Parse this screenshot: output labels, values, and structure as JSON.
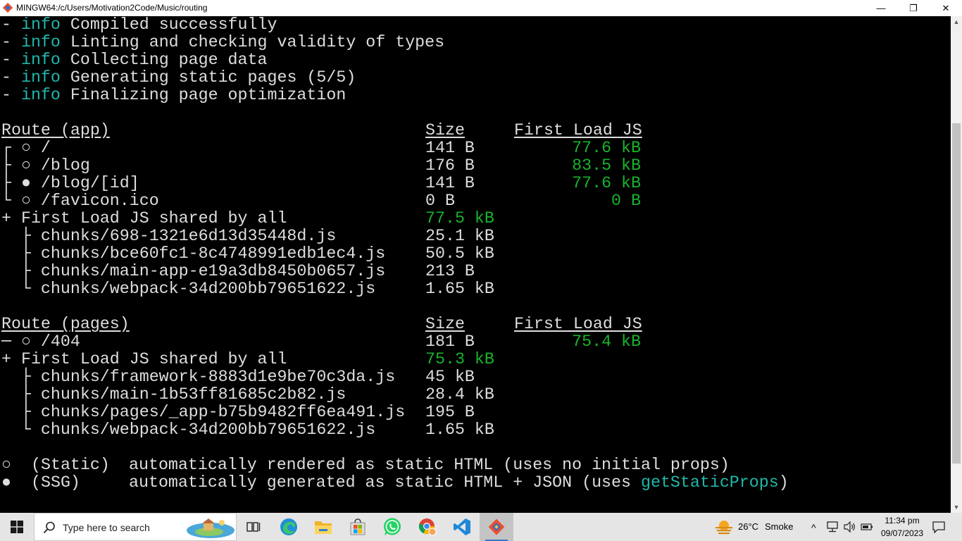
{
  "window": {
    "title": "MINGW64:/c/Users/Motivation2Code/Music/routing",
    "minimize_glyph": "—",
    "restore_glyph": "❐",
    "close_glyph": "✕"
  },
  "terminal": {
    "info_lines": [
      {
        "dash": "- ",
        "tag": "info",
        "text": " Compiled successfully"
      },
      {
        "dash": "- ",
        "tag": "info",
        "text": " Linting and checking validity of types"
      },
      {
        "dash": "- ",
        "tag": "info",
        "text": " Collecting page data"
      },
      {
        "dash": "- ",
        "tag": "info",
        "text": " Generating static pages (5/5)"
      },
      {
        "dash": "- ",
        "tag": "info",
        "text": " Finalizing page optimization"
      }
    ],
    "app_table": {
      "headers": {
        "route": "Route (app)",
        "size": "Size",
        "first_load": "First Load JS"
      },
      "rows": [
        {
          "prefix": "┌ ○ ",
          "route": "/",
          "size": "141 B",
          "first_load": "77.6 kB"
        },
        {
          "prefix": "├ ○ ",
          "route": "/blog",
          "size": "176 B",
          "first_load": "83.5 kB"
        },
        {
          "prefix": "├ ● ",
          "route": "/blog/[id]",
          "size": "141 B",
          "first_load": "77.6 kB"
        },
        {
          "prefix": "└ ○ ",
          "route": "/favicon.ico",
          "size": "0 B",
          "first_load": "0 B"
        }
      ],
      "shared": {
        "prefix": "+ ",
        "label": "First Load JS shared by all",
        "size": "77.5 kB"
      },
      "chunks": [
        {
          "prefix": "  ├ ",
          "name": "chunks/698-1321e6d13d35448d.js",
          "size": "25.1 kB"
        },
        {
          "prefix": "  ├ ",
          "name": "chunks/bce60fc1-8c4748991edb1ec4.js",
          "size": "50.5 kB"
        },
        {
          "prefix": "  ├ ",
          "name": "chunks/main-app-e19a3db8450b0657.js",
          "size": "213 B"
        },
        {
          "prefix": "  └ ",
          "name": "chunks/webpack-34d200bb79651622.js",
          "size": "1.65 kB"
        }
      ]
    },
    "pages_table": {
      "headers": {
        "route": "Route (pages)",
        "size": "Size",
        "first_load": "First Load JS"
      },
      "rows": [
        {
          "prefix": "─ ○ ",
          "route": "/404",
          "size": "181 B",
          "first_load": "75.4 kB"
        }
      ],
      "shared": {
        "prefix": "+ ",
        "label": "First Load JS shared by all",
        "size": "75.3 kB"
      },
      "chunks": [
        {
          "prefix": "  ├ ",
          "name": "chunks/framework-8883d1e9be70c3da.js",
          "size": "45 kB"
        },
        {
          "prefix": "  ├ ",
          "name": "chunks/main-1b53ff81685c2b82.js",
          "size": "28.4 kB"
        },
        {
          "prefix": "  ├ ",
          "name": "chunks/pages/_app-b75b9482ff6ea491.js",
          "size": "195 B"
        },
        {
          "prefix": "  └ ",
          "name": "chunks/webpack-34d200bb79651622.js",
          "size": "1.65 kB"
        }
      ]
    },
    "legend": [
      {
        "symbol": "○",
        "kind": "(Static)",
        "text": "automatically rendered as static HTML (uses no initial props)",
        "highlight": "",
        "suffix": ""
      },
      {
        "symbol": "●",
        "kind": "(SSG)",
        "text": "automatically generated as static HTML + JSON (uses ",
        "highlight": "getStaticProps",
        "suffix": ")"
      }
    ]
  },
  "scrollbar": {
    "up_glyph": "▲",
    "down_glyph": "▼"
  },
  "taskbar": {
    "search_placeholder": "Type here to search",
    "weather": {
      "temp": "26°C",
      "condition": "Smoke"
    },
    "clock": {
      "time": "11:34 pm",
      "date": "09/07/2023"
    },
    "tray_chevron": "^",
    "pinned_icons": [
      "task-view-icon",
      "edge-icon",
      "file-explorer-icon",
      "microsoft-store-icon",
      "whatsapp-icon",
      "chrome-icon",
      "vscode-icon",
      "git-bash-icon"
    ]
  },
  "colors": {
    "terminal_bg": "#000000",
    "terminal_text": "#dedede",
    "info_cyan": "#1fb8aa",
    "size_green": "#19b32c",
    "taskbar_bg": "#e5e5e5"
  }
}
